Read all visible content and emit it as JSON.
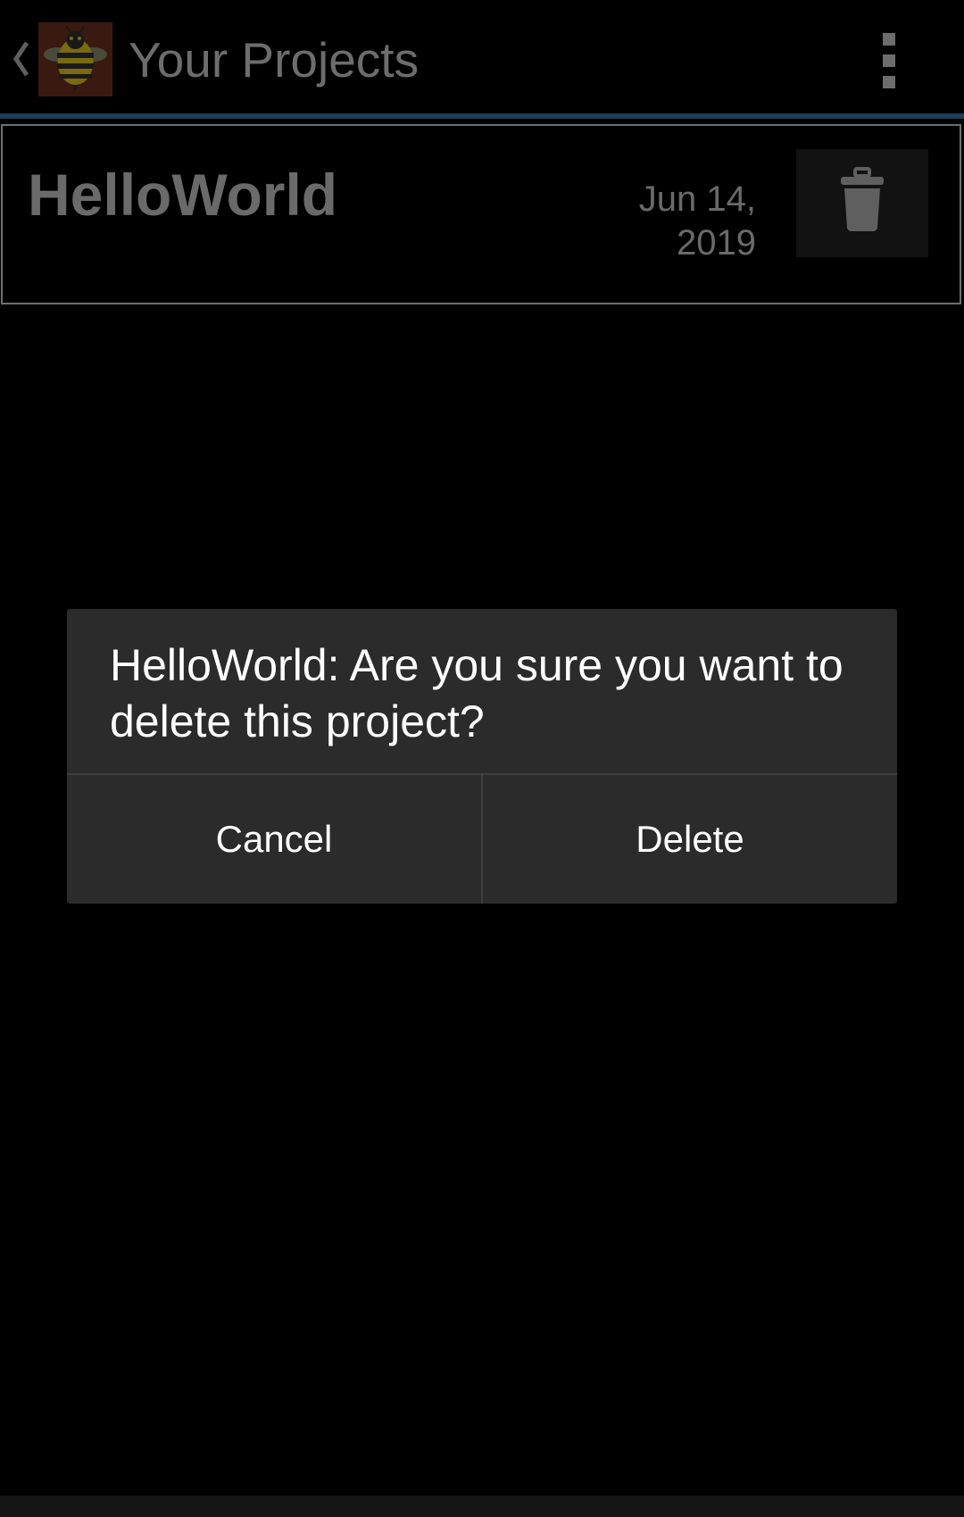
{
  "action_bar": {
    "title": "Your Projects",
    "accent_color": "#1c3f55",
    "up_icon": "chevron-left-icon",
    "app_icon": "bee-icon",
    "menu_icon": "overflow-menu-icon"
  },
  "projects": [
    {
      "name": "HelloWorld",
      "date": "Jun 14, 2019",
      "delete_icon": "trash-icon"
    }
  ],
  "dialog": {
    "message": "HelloWorld: Are you sure you want to delete this project?",
    "cancel_label": "Cancel",
    "delete_label": "Delete"
  }
}
